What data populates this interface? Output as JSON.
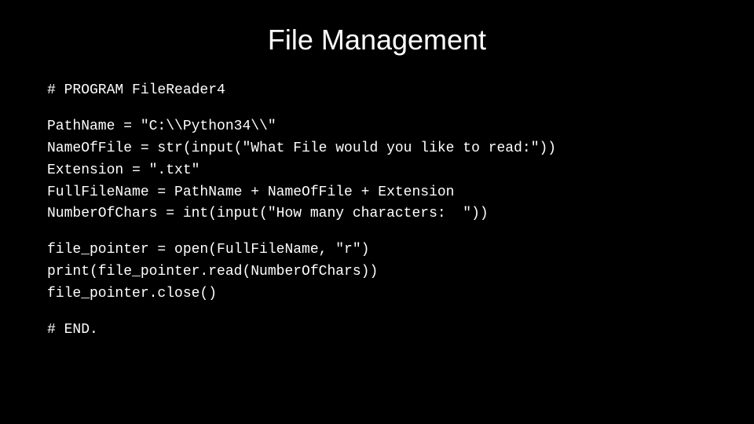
{
  "slide": {
    "title": "File Management",
    "code_sections": [
      {
        "id": "comment-program",
        "text": "# PROGRAM FileReader4"
      },
      {
        "id": "main-code",
        "text": "PathName = \"C:\\\\Python34\\\\\"\nNameOfFile = str(input(\"What File would you like to read:\"))\nExtension = \".txt\"\nFullFileName = PathName + NameOfFile + Extension\nNumberOfChars = int(input(\"How many characters:  \"))"
      },
      {
        "id": "file-ops",
        "text": "file_pointer = open(FullFileName, \"r\")\nprint(file_pointer.read(NumberOfChars))\nfile_pointer.close()"
      },
      {
        "id": "comment-end",
        "text": "# END."
      }
    ]
  }
}
